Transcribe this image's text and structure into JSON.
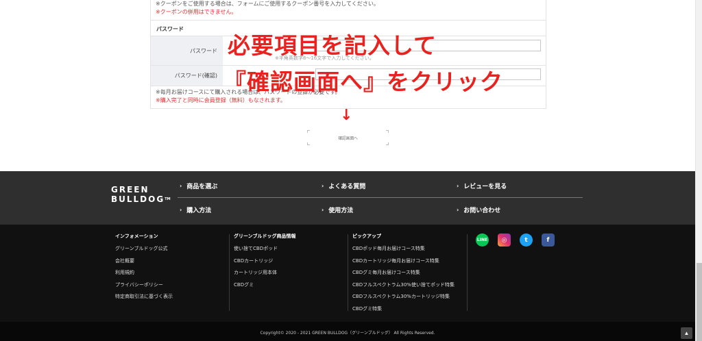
{
  "form": {
    "coupon_notes": [
      "※クーポンをご使用する場合は、フォームにご使用するクーポン番号を入力してください。",
      "※クーポンの併用はできません。"
    ],
    "password_section_title": "パスワード",
    "password_label": "パスワード",
    "password_hint": "※半角英数字8〜16文字で入力してください。",
    "password_confirm_label": "パスワード(確認)",
    "bottom_notes": [
      "※毎月お届けコースにて購入される場合は、パスワードの登録が必要です。",
      "※購入完了と同時に会員登録（無料）もなされます。"
    ],
    "confirm_button_label": "確認画面へ"
  },
  "overlay": {
    "line1": "必要項目を記入して",
    "line2": "『確認画面へ』をクリック",
    "arrow": "↓",
    "color": "#e8231f"
  },
  "nav": {
    "logo_line1": "GREEN",
    "logo_line2": "BULLDOG",
    "logo_tm": "TM",
    "links": [
      {
        "label": "商品を選ぶ"
      },
      {
        "label": "よくある質問"
      },
      {
        "label": "レビューを見る"
      },
      {
        "label": "購入方法"
      },
      {
        "label": "使用方法"
      },
      {
        "label": "お問い合わせ"
      }
    ],
    "chevron": "›"
  },
  "footer": {
    "columns": [
      {
        "title": "インフォメーション",
        "items": [
          "グリーンブルドッグ公式",
          "会社概要",
          "利用規約",
          "プライバシーポリシー",
          "特定商取引法に基づく表示"
        ]
      },
      {
        "title": "グリーンブルドッグ商品情報",
        "items": [
          "使い捨てCBDポッド",
          "CBDカートリッジ",
          "カートリッジ用本体",
          "CBDグミ"
        ]
      },
      {
        "title": "ピックアップ",
        "items": [
          "CBDポッド毎月お届けコース特集",
          "CBDカートリッジ毎月お届けコース特集",
          "CBDグミ毎月お届けコース特集",
          "CBDフルスペクトラム30%使い捨てポッド特集",
          "CBDフルスペクトラム30%カートリッジ特集",
          "CBDグミ特集"
        ]
      }
    ],
    "social": [
      {
        "name": "line-icon",
        "glyph": "LINE"
      },
      {
        "name": "instagram-icon",
        "glyph": "◎"
      },
      {
        "name": "twitter-icon",
        "glyph": "t"
      },
      {
        "name": "facebook-icon",
        "glyph": "f"
      }
    ],
    "copyright": "Copyright© 2020 - 2021 GREEN BULLDOG（グリーンブルドッグ） All Rights Reserved.",
    "to_top_glyph": "▲"
  }
}
